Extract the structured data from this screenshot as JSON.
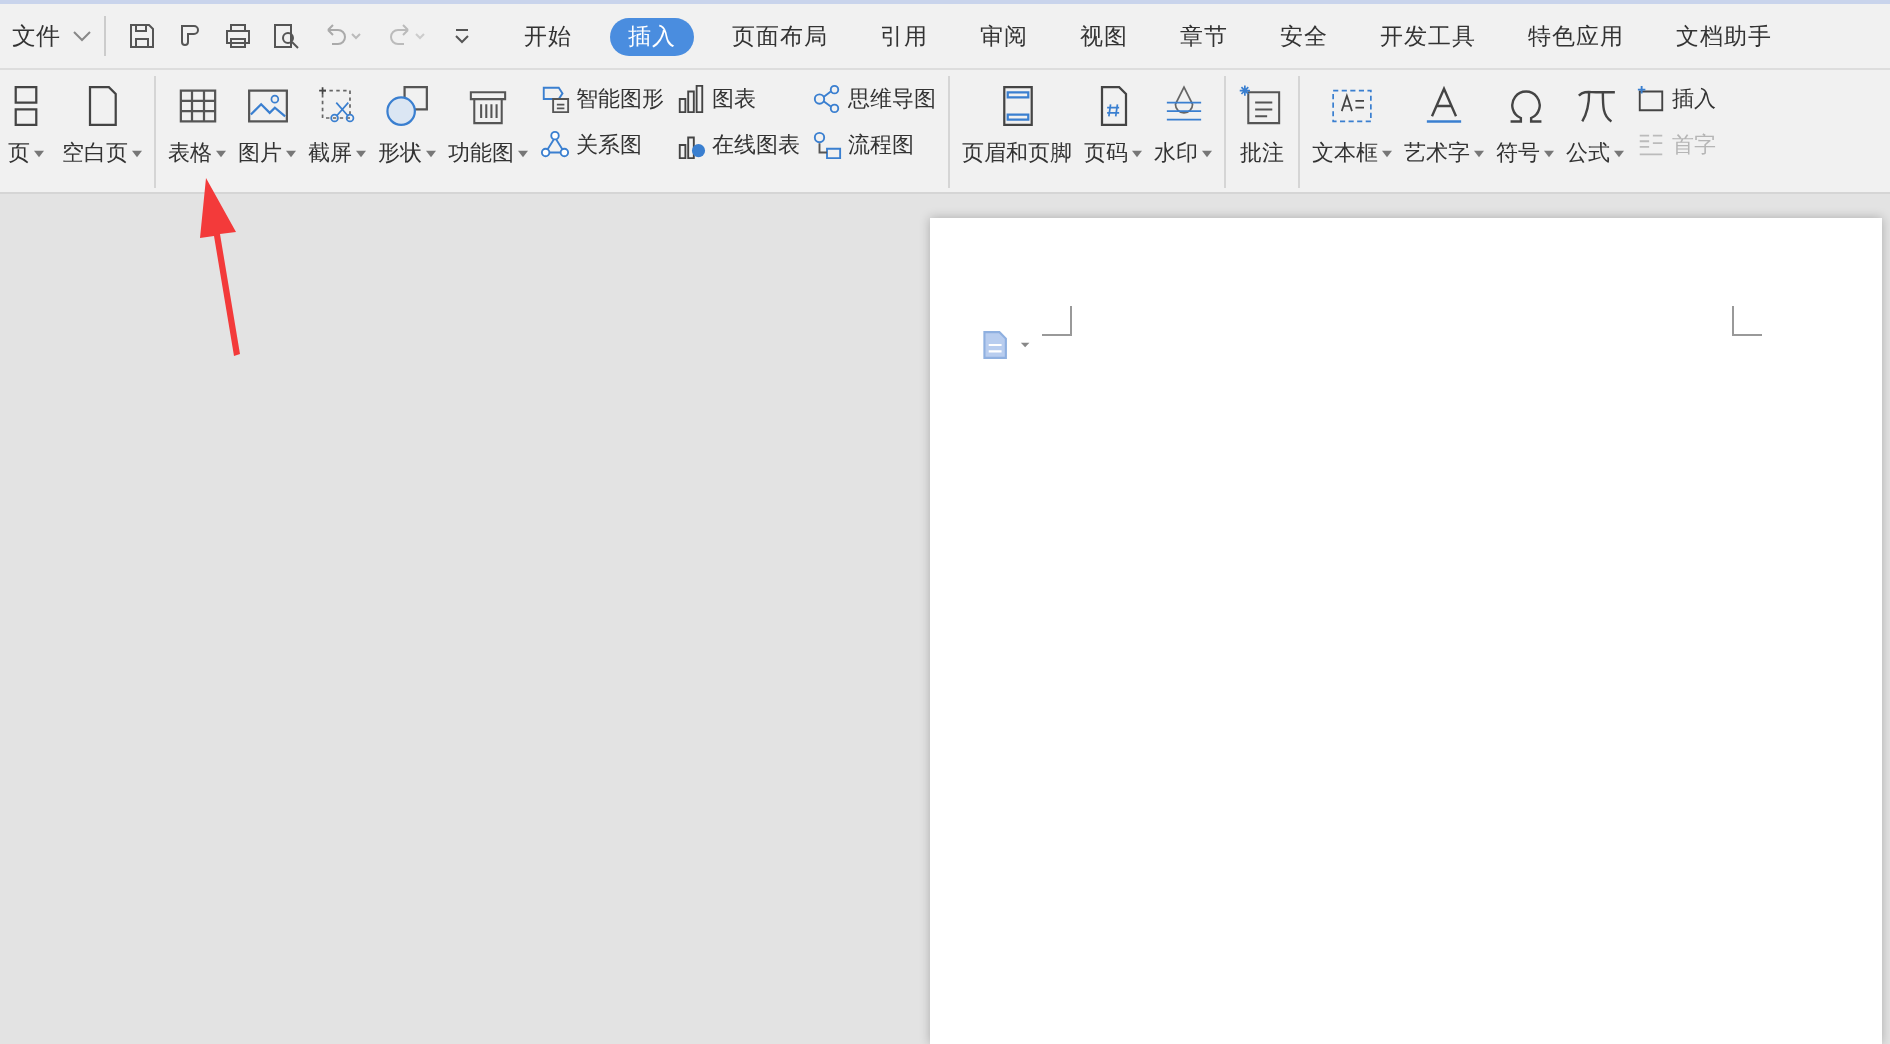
{
  "menu": {
    "file_label": "文件"
  },
  "tabs": [
    {
      "label": "开始",
      "selected": false
    },
    {
      "label": "插入",
      "selected": true
    },
    {
      "label": "页面布局",
      "selected": false
    },
    {
      "label": "引用",
      "selected": false
    },
    {
      "label": "审阅",
      "selected": false
    },
    {
      "label": "视图",
      "selected": false
    },
    {
      "label": "章节",
      "selected": false
    },
    {
      "label": "安全",
      "selected": false
    },
    {
      "label": "开发工具",
      "selected": false
    },
    {
      "label": "特色应用",
      "selected": false
    },
    {
      "label": "文档助手",
      "selected": false
    }
  ],
  "ribbon": [
    {
      "kind": "large",
      "label": "页",
      "dropdown": true
    },
    {
      "kind": "large",
      "label": "空白页",
      "dropdown": true
    },
    {
      "kind": "separator"
    },
    {
      "kind": "large",
      "label": "表格",
      "dropdown": true
    },
    {
      "kind": "large",
      "label": "图片",
      "dropdown": true
    },
    {
      "kind": "large",
      "label": "截屏",
      "dropdown": true
    },
    {
      "kind": "large",
      "label": "形状",
      "dropdown": true
    },
    {
      "kind": "large",
      "label": "功能图",
      "dropdown": true
    },
    {
      "kind": "stack",
      "items": [
        {
          "label": "智能图形",
          "disabled": false
        },
        {
          "label": "关系图",
          "disabled": false
        }
      ]
    },
    {
      "kind": "stack",
      "items": [
        {
          "label": "图表",
          "disabled": false
        },
        {
          "label": "在线图表",
          "disabled": false
        }
      ]
    },
    {
      "kind": "stack",
      "items": [
        {
          "label": "思维导图",
          "disabled": false
        },
        {
          "label": "流程图",
          "disabled": false
        }
      ]
    },
    {
      "kind": "separator"
    },
    {
      "kind": "large",
      "label": "页眉和页脚",
      "dropdown": false
    },
    {
      "kind": "large",
      "label": "页码",
      "dropdown": true
    },
    {
      "kind": "large",
      "label": "水印",
      "dropdown": true
    },
    {
      "kind": "separator"
    },
    {
      "kind": "large",
      "label": "批注",
      "dropdown": false
    },
    {
      "kind": "separator"
    },
    {
      "kind": "large",
      "label": "文本框",
      "dropdown": true
    },
    {
      "kind": "large",
      "label": "艺术字",
      "dropdown": true
    },
    {
      "kind": "large",
      "label": "符号",
      "dropdown": true
    },
    {
      "kind": "large",
      "label": "公式",
      "dropdown": true
    },
    {
      "kind": "stack",
      "items": [
        {
          "label": "插入",
          "disabled": false
        },
        {
          "label": "首字",
          "disabled": true
        }
      ]
    }
  ]
}
